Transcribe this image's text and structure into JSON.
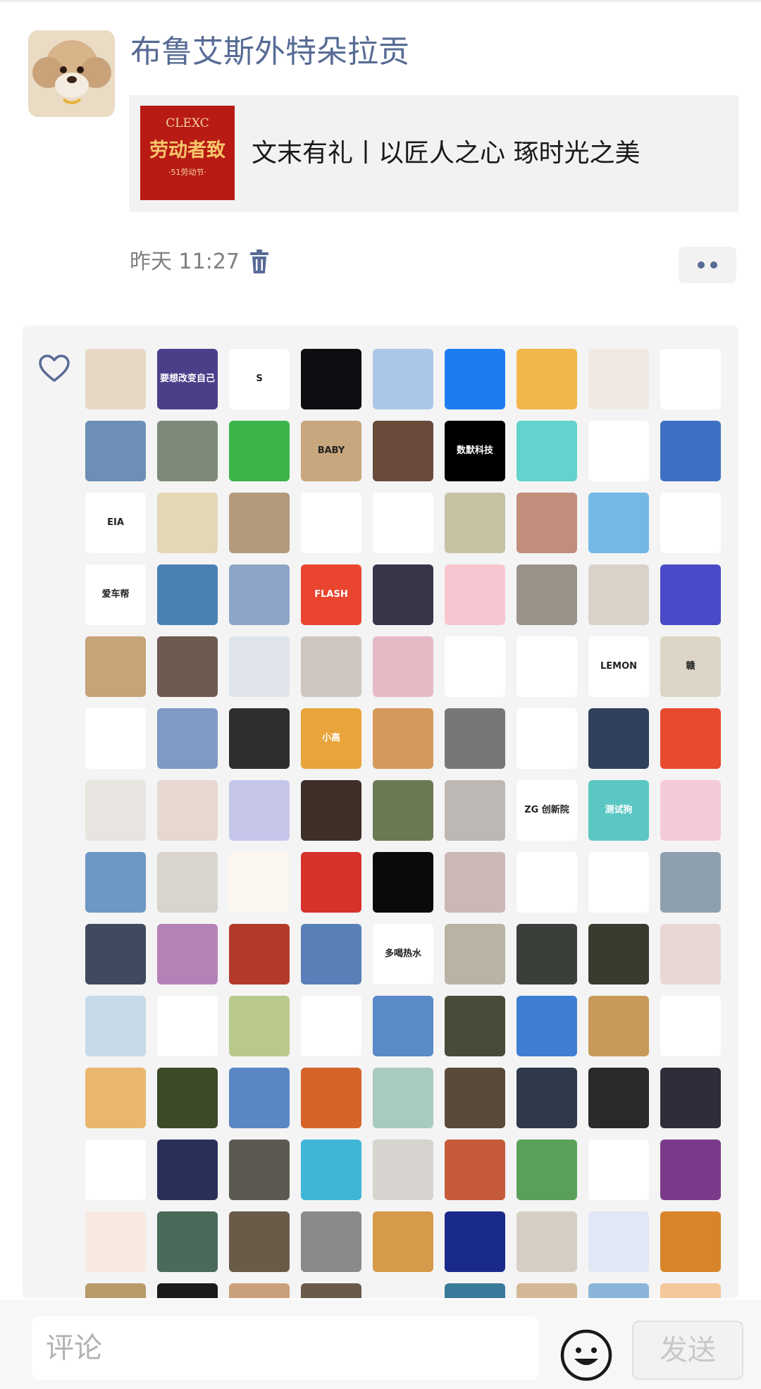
{
  "post": {
    "author_name": "布鲁艾斯外特朵拉贡",
    "avatar_icon": "poodle-avatar-icon",
    "link_card": {
      "thumb_brand": "CLEXC",
      "thumb_headline": "劳动者致",
      "thumb_subtitle": "·51劳动节·",
      "title": "文末有礼丨以匠人之心 琢时光之美"
    },
    "timestamp": "昨天 11:27",
    "delete_icon": "trash-icon",
    "more_icon": "more-dots-icon"
  },
  "likes": {
    "heart_icon": "heart-outline-icon",
    "avatars": [
      {
        "name": "poodle",
        "bg": "#e6d8c2",
        "text": ""
      },
      {
        "name": "quote-purple",
        "bg": "#4b3f8a",
        "text": "要想改变自己"
      },
      {
        "name": "black-s-logo",
        "bg": "#ffffff",
        "text": "S"
      },
      {
        "name": "astronaut",
        "bg": "#0e0e12",
        "text": ""
      },
      {
        "name": "duck",
        "bg": "#a9c8e8",
        "text": ""
      },
      {
        "name": "balloons-app",
        "bg": "#1e7cf2",
        "text": ""
      },
      {
        "name": "girl-yellow",
        "bg": "#f2b64a",
        "text": ""
      },
      {
        "name": "man-glasses",
        "bg": "#f1e9e1",
        "text": ""
      },
      {
        "name": "green-mascot",
        "bg": "#ffffff",
        "text": ""
      },
      {
        "name": "lake",
        "bg": "#6d8fb5",
        "text": ""
      },
      {
        "name": "castle",
        "bg": "#7d8a78",
        "text": ""
      },
      {
        "name": "green-crown",
        "bg": "#3bb44a",
        "text": ""
      },
      {
        "name": "baby",
        "bg": "#c9a77e",
        "text": "BABY"
      },
      {
        "name": "boy-hands",
        "bg": "#6a4a3a",
        "text": ""
      },
      {
        "name": "tech-black",
        "bg": "#000000",
        "text": "数默科技"
      },
      {
        "name": "lamp-teal",
        "bg": "#62d3cd",
        "text": ""
      },
      {
        "name": "woman-sunglasses",
        "bg": "#ffffff",
        "text": ""
      },
      {
        "name": "building-sky",
        "bg": "#3d6fc4",
        "text": ""
      },
      {
        "name": "eia-logo",
        "bg": "#ffffff",
        "text": "EIA"
      },
      {
        "name": "kid-lakers",
        "bg": "#e3d7b6",
        "text": ""
      },
      {
        "name": "sunset-walker",
        "bg": "#b39a7c",
        "text": ""
      },
      {
        "name": "lion",
        "bg": "#ffffff",
        "text": ""
      },
      {
        "name": "cat-doodle",
        "bg": "#ffffff",
        "text": ""
      },
      {
        "name": "hallway",
        "bg": "#c7c2a4",
        "text": ""
      },
      {
        "name": "girl-smile",
        "bg": "#c28e7b",
        "text": ""
      },
      {
        "name": "sunflower",
        "bg": "#74b8e6",
        "text": ""
      },
      {
        "name": "small-flower",
        "bg": "#ffffff",
        "text": ""
      },
      {
        "name": "car-club",
        "bg": "#ffffff",
        "text": "爱车帮"
      },
      {
        "name": "sea-blue",
        "bg": "#4b80b4",
        "text": ""
      },
      {
        "name": "eiffel",
        "bg": "#8da6c8",
        "text": ""
      },
      {
        "name": "flash",
        "bg": "#e9452f",
        "text": "FLASH"
      },
      {
        "name": "girl-anime",
        "bg": "#3a3448",
        "text": ""
      },
      {
        "name": "pink-glow",
        "bg": "#f7c6d0",
        "text": ""
      },
      {
        "name": "panda-basket",
        "bg": "#9a9289",
        "text": ""
      },
      {
        "name": "man-baby",
        "bg": "#d9d2c8",
        "text": ""
      },
      {
        "name": "boy-pixel",
        "bg": "#4a4ac8",
        "text": ""
      },
      {
        "name": "dog-face",
        "bg": "#c7a37a",
        "text": ""
      },
      {
        "name": "flowers-vase",
        "bg": "#6e5a50",
        "text": ""
      },
      {
        "name": "anime-man",
        "bg": "#dfe4ea",
        "text": ""
      },
      {
        "name": "plush-white",
        "bg": "#cfc6bf",
        "text": ""
      },
      {
        "name": "pink-tree",
        "bg": "#e7b9c4",
        "text": ""
      },
      {
        "name": "tree-people",
        "bg": "#ffffff",
        "text": ""
      },
      {
        "name": "ninja-bubble",
        "bg": "#ffffff",
        "text": ""
      },
      {
        "name": "lemon",
        "bg": "#ffffff",
        "text": "LEMON"
      },
      {
        "name": "calligraphy",
        "bg": "#ddd6c6",
        "text": "赣"
      },
      {
        "name": "girl-bow",
        "bg": "#ffffff",
        "text": ""
      },
      {
        "name": "bridge",
        "bg": "#7f9ac4",
        "text": ""
      },
      {
        "name": "window-girl",
        "bg": "#2e2e2c",
        "text": ""
      },
      {
        "name": "orange-circle",
        "bg": "#e9a53b",
        "text": "小高"
      },
      {
        "name": "shiba",
        "bg": "#d49a5c",
        "text": ""
      },
      {
        "name": "woman-bw",
        "bg": "#777777",
        "text": ""
      },
      {
        "name": "ghost-bread",
        "bg": "#ffffff",
        "text": ""
      },
      {
        "name": "horse",
        "bg": "#2f3f5c",
        "text": ""
      },
      {
        "name": "goku",
        "bg": "#e84a2e",
        "text": ""
      },
      {
        "name": "man-suit",
        "bg": "#e8e4df",
        "text": ""
      },
      {
        "name": "bearded-man",
        "bg": "#e6d8d0",
        "text": ""
      },
      {
        "name": "sketch-lavender",
        "bg": "#c5c6ea",
        "text": ""
      },
      {
        "name": "door-dancer",
        "bg": "#3e3028",
        "text": ""
      },
      {
        "name": "panda",
        "bg": "#6b7a52",
        "text": ""
      },
      {
        "name": "woman-stand",
        "bg": "#bdb8b3",
        "text": ""
      },
      {
        "name": "zg-logo",
        "bg": "#ffffff",
        "text": "ZG 创新院"
      },
      {
        "name": "test-dog",
        "bg": "#5bc7c3",
        "text": "测试狗"
      },
      {
        "name": "pink-heart",
        "bg": "#f5cad8",
        "text": ""
      },
      {
        "name": "girl-sea",
        "bg": "#6d97c4",
        "text": ""
      },
      {
        "name": "red-skirt",
        "bg": "#d9d4ce",
        "text": ""
      },
      {
        "name": "yellow-girl",
        "bg": "#fbf6ef",
        "text": ""
      },
      {
        "name": "red-lion-girl",
        "bg": "#d6312b",
        "text": ""
      },
      {
        "name": "moon",
        "bg": "#0a0a0a",
        "text": ""
      },
      {
        "name": "anime-girl",
        "bg": "#cbb8b6",
        "text": ""
      },
      {
        "name": "robot-head",
        "bg": "#ffffff",
        "text": ""
      },
      {
        "name": "cat-sketch",
        "bg": "#ffffff",
        "text": ""
      },
      {
        "name": "beach",
        "bg": "#8ea0b0",
        "text": ""
      },
      {
        "name": "magazine-man",
        "bg": "#3f4a5e",
        "text": ""
      },
      {
        "name": "anime-pink",
        "bg": "#b582b8",
        "text": ""
      },
      {
        "name": "astronaut-red",
        "bg": "#b33a2b",
        "text": ""
      },
      {
        "name": "boy-blue",
        "bg": "#5a7fb8",
        "text": ""
      },
      {
        "name": "drink-water",
        "bg": "#ffffff",
        "text": "多喝热水"
      },
      {
        "name": "surprised-cat",
        "bg": "#b9b3a6",
        "text": ""
      },
      {
        "name": "street-silhouette",
        "bg": "#3a3f3a",
        "text": ""
      },
      {
        "name": "tiger-cat",
        "bg": "#3b3a2e",
        "text": ""
      },
      {
        "name": "baby-shine",
        "bg": "#e8d8d4",
        "text": ""
      },
      {
        "name": "snow-bird",
        "bg": "#c6daea",
        "text": ""
      },
      {
        "name": "panda-cartoon",
        "bg": "#ffffff",
        "text": ""
      },
      {
        "name": "wedding",
        "bg": "#b9c98e",
        "text": ""
      },
      {
        "name": "hearts-boy",
        "bg": "#ffffff",
        "text": ""
      },
      {
        "name": "blue-toy",
        "bg": "#5a8ac8",
        "text": ""
      },
      {
        "name": "subway",
        "bg": "#4a4a3a",
        "text": ""
      },
      {
        "name": "field-sky",
        "bg": "#3f7fd3",
        "text": ""
      },
      {
        "name": "alien-box",
        "bg": "#c79a5a",
        "text": ""
      },
      {
        "name": "cartoon-runner",
        "bg": "#ffffff",
        "text": ""
      },
      {
        "name": "crayon-sky",
        "bg": "#e9b66f",
        "text": ""
      },
      {
        "name": "tree-savanna",
        "bg": "#3d4a2a",
        "text": ""
      },
      {
        "name": "mountains",
        "bg": "#5a86c3",
        "text": ""
      },
      {
        "name": "angry-owl",
        "bg": "#d6642a",
        "text": ""
      },
      {
        "name": "family",
        "bg": "#a7cbbd",
        "text": ""
      },
      {
        "name": "anime-boy",
        "bg": "#5a4a3a",
        "text": ""
      },
      {
        "name": "dusk-man",
        "bg": "#2f3a4a",
        "text": ""
      },
      {
        "name": "long-hair",
        "bg": "#2a2a2a",
        "text": ""
      },
      {
        "name": "elevator",
        "bg": "#2e2e3a",
        "text": ""
      },
      {
        "name": "sketch-face",
        "bg": "#ffffff",
        "text": ""
      },
      {
        "name": "moon-pig",
        "bg": "#2a2f5a",
        "text": ""
      },
      {
        "name": "hat-lady",
        "bg": "#5c5a50",
        "text": ""
      },
      {
        "name": "smiley",
        "bg": "#3fb6d8",
        "text": ""
      },
      {
        "name": "dark-hair",
        "bg": "#d7d3ce",
        "text": ""
      },
      {
        "name": "boy-red",
        "bg": "#c65a3a",
        "text": ""
      },
      {
        "name": "pepe",
        "bg": "#5aa05a",
        "text": ""
      },
      {
        "name": "glasses-boy",
        "bg": "#ffffff",
        "text": ""
      },
      {
        "name": "grin-man",
        "bg": "#7a3a8a",
        "text": ""
      },
      {
        "name": "pig",
        "bg": "#f7e9e0",
        "text": ""
      },
      {
        "name": "guitar",
        "bg": "#4a6a5a",
        "text": ""
      },
      {
        "name": "piano",
        "bg": "#6a5a48",
        "text": ""
      },
      {
        "name": "white-dog",
        "bg": "#8a8a8a",
        "text": ""
      },
      {
        "name": "valley",
        "bg": "#d69a4a",
        "text": ""
      },
      {
        "name": "blue-moon",
        "bg": "#1a2a8a",
        "text": ""
      },
      {
        "name": "sleeping",
        "bg": "#d8cfc4",
        "text": ""
      },
      {
        "name": "bed-cartoon",
        "bg": "#dfe8f4",
        "text": ""
      },
      {
        "name": "sunset-road",
        "bg": "#d8852a",
        "text": ""
      },
      {
        "name": "partial-1",
        "bg": "#b89a6a",
        "text": ""
      },
      {
        "name": "partial-2",
        "bg": "#1a1a1a",
        "text": ""
      },
      {
        "name": "partial-3",
        "bg": "#c9a07a",
        "text": ""
      },
      {
        "name": "partial-4",
        "bg": "#6a5a4a",
        "text": ""
      },
      {
        "name": "partial-5",
        "bg": "#f4f4f4",
        "text": ""
      },
      {
        "name": "partial-6",
        "bg": "#3a7a9a",
        "text": ""
      },
      {
        "name": "partial-7",
        "bg": "#d4b896",
        "text": ""
      },
      {
        "name": "partial-8",
        "bg": "#8ab4d8",
        "text": ""
      },
      {
        "name": "partial-9",
        "bg": "#f4c89a",
        "text": ""
      }
    ]
  },
  "composer": {
    "placeholder": "评论",
    "emoji_icon": "smiley-face-icon",
    "send_label": "发送"
  },
  "colors": {
    "author_name": "#576b95",
    "link_card_bg": "#f2f2f2",
    "likes_bg": "#f4f4f4",
    "send_disabled": "#c8c8c8"
  }
}
